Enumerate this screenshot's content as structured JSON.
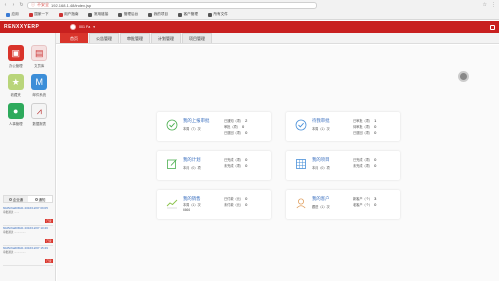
{
  "browser": {
    "warning": "不安全",
    "url": "192.168.1.48/index.jsp",
    "bookmarks": [
      "应用",
      "国家一下",
      "用户指南",
      "常用链接",
      "管理后台",
      "我的项目",
      "客户管理",
      "所有文件"
    ]
  },
  "app": {
    "logo": "RENXXYERP",
    "user_name": "001  Fa",
    "brand_color": "#c8201f"
  },
  "tabs": [
    {
      "label": "首页",
      "active": true
    },
    {
      "label": "公告管理"
    },
    {
      "label": "审批管理"
    },
    {
      "label": "计划管理"
    },
    {
      "label": "项目管理"
    }
  ],
  "sidebar": {
    "apps": [
      {
        "label": "办公管理",
        "icon": "building-icon"
      },
      {
        "label": "文员库",
        "icon": "document-icon"
      },
      {
        "label": "收藏夹",
        "icon": "star-icon"
      },
      {
        "label": "邮件系统",
        "icon": "mail-icon"
      },
      {
        "label": "人事管理",
        "icon": "person-icon"
      },
      {
        "label": "数据报表",
        "icon": "chart-icon"
      }
    ],
    "tabs": [
      "企业通",
      "通知"
    ],
    "feed": [
      {
        "id": "60d5c6a60f0d1 2016/12/07 09:05",
        "desc": "审批通过 .......",
        "badge": "已读"
      },
      {
        "id": "60d5c6a60f0d1 2016/12/07 10:46",
        "desc": "审批通过 ................",
        "badge": "已读"
      },
      {
        "id": "60d5c6a60f0d1 2016/12/07 15:49",
        "desc": "审批通过 ................",
        "badge": "已读"
      }
    ]
  },
  "cards": [
    {
      "title": "我的上报审批",
      "sub": "本周（7）次",
      "icon": "check-circle-icon",
      "stats": [
        {
          "label": "已通知（项）",
          "value": "2"
        },
        {
          "label": "审批（项）",
          "value": "0"
        },
        {
          "label": "已退回（项）",
          "value": "0"
        }
      ]
    },
    {
      "title": "待我审批",
      "sub": "本周（1）次",
      "icon": "check-circle-icon",
      "stats": [
        {
          "label": "已审批（项）",
          "value": "1"
        },
        {
          "label": "待审批（项）",
          "value": "0"
        },
        {
          "label": "已退回（项）",
          "value": "0"
        }
      ]
    },
    {
      "title": "我的计划",
      "sub": "本月（0）项",
      "icon": "edit-icon",
      "stats": [
        {
          "label": "已完成（项）",
          "value": "0"
        },
        {
          "label": "未完成（项）",
          "value": "0"
        }
      ]
    },
    {
      "title": "我的项目",
      "sub": "本月（0）项",
      "icon": "grid-icon",
      "stats": [
        {
          "label": "已完成（项）",
          "value": "0"
        },
        {
          "label": "未完成（项）",
          "value": "0"
        }
      ]
    },
    {
      "title": "我的销售",
      "sub": "本周（1）次",
      "sub2": "6666",
      "icon": "trend-icon",
      "stats": [
        {
          "label": "已付款（元）",
          "value": "0"
        },
        {
          "label": "未付款（元）",
          "value": "0"
        }
      ]
    },
    {
      "title": "我的客户",
      "sub": "跟进（1）次",
      "icon": "contact-icon",
      "stats": [
        {
          "label": "新客户（个）",
          "value": "3"
        },
        {
          "label": "老客户（个）",
          "value": "0"
        }
      ]
    }
  ]
}
